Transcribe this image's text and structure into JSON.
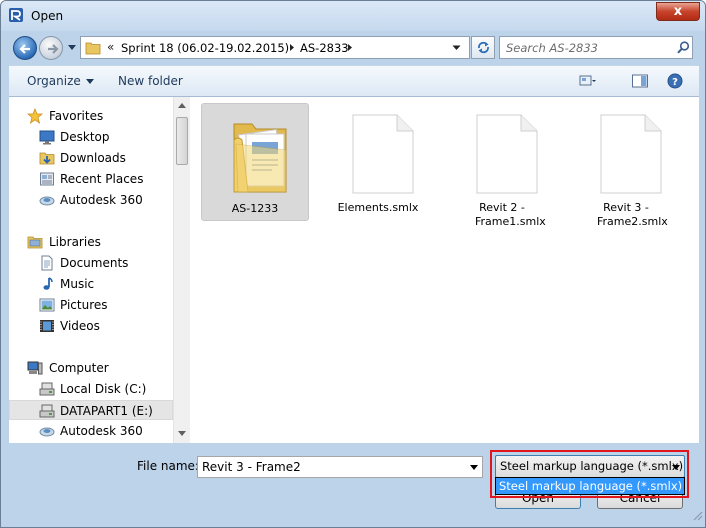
{
  "window": {
    "title": "Open",
    "close_label": "x"
  },
  "address": {
    "chevrons": "«",
    "crumbs": [
      "Sprint 18 (06.02-19.02.2015)",
      "AS-2833"
    ]
  },
  "search": {
    "placeholder": "Search AS-2833"
  },
  "toolbar": {
    "organize_label": "Organize",
    "new_folder_label": "New folder"
  },
  "nav": {
    "favorites": {
      "label": "Favorites",
      "items": [
        "Desktop",
        "Downloads",
        "Recent Places",
        "Autodesk 360"
      ]
    },
    "libraries": {
      "label": "Libraries",
      "items": [
        "Documents",
        "Music",
        "Pictures",
        "Videos"
      ]
    },
    "computer": {
      "label": "Computer",
      "items": [
        "Local Disk (C:)",
        "DATAPART1 (E:)",
        "Autodesk 360"
      ],
      "selected": "DATAPART1 (E:)"
    }
  },
  "files": [
    {
      "name": "AS-1233",
      "type": "folder",
      "selected": true
    },
    {
      "name": "Elements.smlx",
      "type": "file"
    },
    {
      "name": "Revit 2 - Frame1.smlx",
      "type": "file"
    },
    {
      "name": "Revit 3 - Frame2.smlx",
      "type": "file"
    }
  ],
  "bottom": {
    "file_name_label": "File name:",
    "file_name_value": "Revit 3 - Frame2",
    "file_type_value": "Steel markup language (*.smlx)",
    "file_type_options": [
      "Steel markup language (*.smlx)"
    ],
    "open_label": "Open",
    "cancel_label": "Cancel"
  },
  "colors": {
    "accent": "#3399ff",
    "highlight": "#e0161c"
  }
}
